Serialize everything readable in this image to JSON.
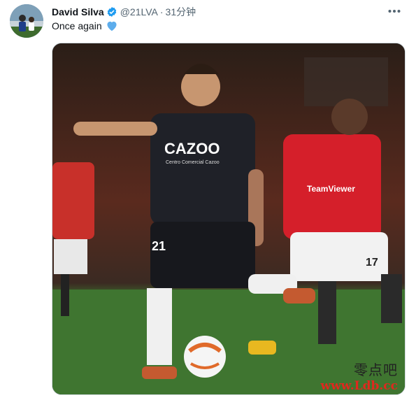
{
  "tweet": {
    "author_name": "David Silva",
    "handle": "@21LVA",
    "separator": "·",
    "time": "31分钟",
    "text": "Once again",
    "emoji": "blue-heart-icon",
    "more_icon": "more-dots-icon",
    "more_label": "···"
  },
  "photo": {
    "shirt_sponsor": "CAZOO",
    "shirt_sponsor_sub": "Centro Comercial Cazoo",
    "player_left_number": "21",
    "player_right_sponsor": "TeamViewer",
    "player_right_number": "17"
  },
  "watermark": {
    "chinese": "零点吧",
    "url": "www.Ldb.cc"
  },
  "colors": {
    "accent": "#1d9bf0",
    "name": "#0f1419",
    "meta": "#536471",
    "watermark_url": "#e0281e"
  }
}
